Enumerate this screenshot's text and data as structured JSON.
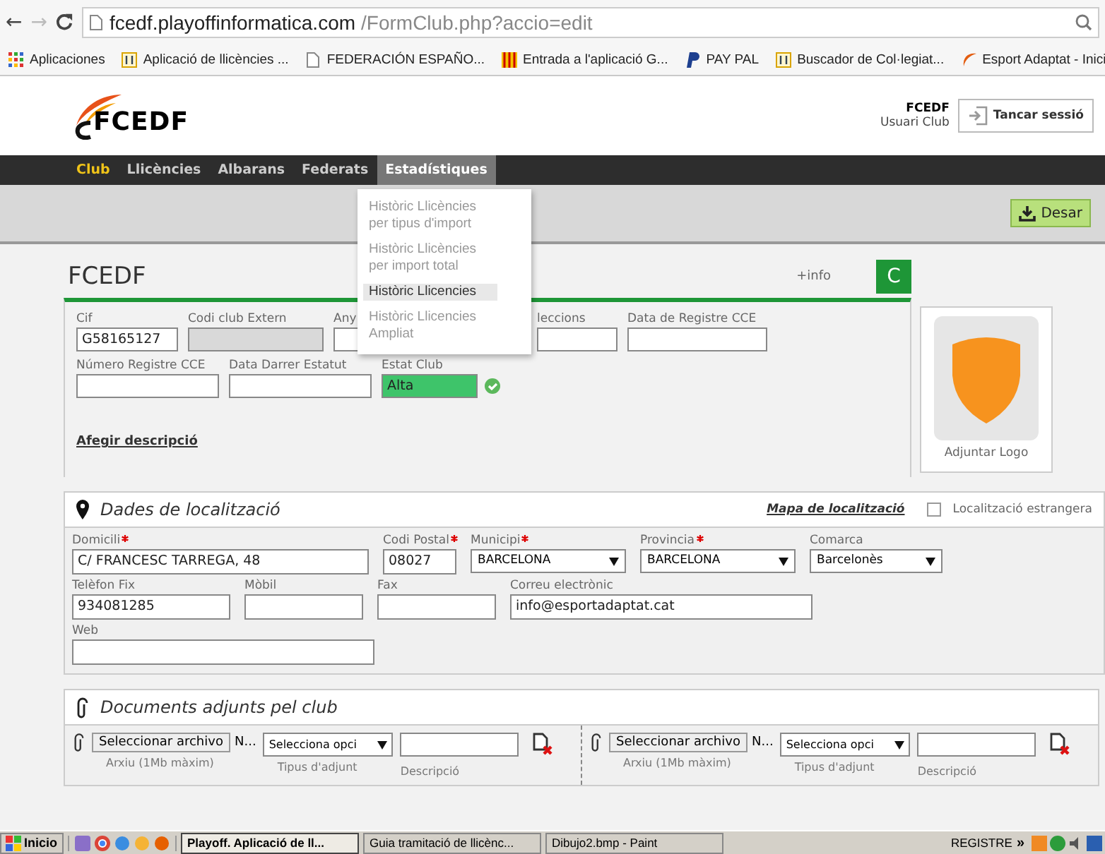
{
  "browser": {
    "back": "←",
    "forward": "→",
    "url_host": "fcedf.playoffinformatica.com",
    "url_path": "/FormClub.php?accio=edit",
    "bookmarks": [
      {
        "label": "Aplicaciones",
        "kind": "apps"
      },
      {
        "label": "Aplicació de llicències ...",
        "kind": "pi"
      },
      {
        "label": "FEDERACIÓN ESPAÑO...",
        "kind": "page"
      },
      {
        "label": "Entrada a l'aplicació G...",
        "kind": "flag"
      },
      {
        "label": "PAY PAL",
        "kind": "paypal"
      },
      {
        "label": "Buscador de Col·legiat...",
        "kind": "pi"
      },
      {
        "label": "Esport Adaptat - Inici",
        "kind": "swoosh"
      }
    ]
  },
  "header": {
    "logo_text": "FCEDF",
    "user_name": "FCEDF",
    "user_role": "Usuari Club",
    "logout": "Tancar sessió"
  },
  "nav": [
    {
      "label": "Club",
      "current": true,
      "open": false
    },
    {
      "label": "Llicències",
      "current": false,
      "open": false
    },
    {
      "label": "Albarans",
      "current": false,
      "open": false
    },
    {
      "label": "Federats",
      "current": false,
      "open": false
    },
    {
      "label": "Estadístiques",
      "current": false,
      "open": true
    }
  ],
  "menu": [
    {
      "label": "Històric Llicències per tipus d'import",
      "selected": false
    },
    {
      "label": "Històric Llicències per import total",
      "selected": false
    },
    {
      "label": "Històric Llicencies",
      "selected": true
    },
    {
      "label": "Històric Llicencies Ampliat",
      "selected": false
    }
  ],
  "toolbar": {
    "save": "Desar"
  },
  "club": {
    "title": "FCEDF",
    "info": "+info",
    "badge": "C",
    "link": "Afegir descripció",
    "logo_label": "Adjuntar Logo",
    "rows": [
      [
        {
          "label": "Cif",
          "value": "G58165127",
          "disabled": false
        },
        {
          "label": "Codi club Extern",
          "disabled": true
        },
        {
          "label": "Any",
          "disabled": false
        },
        {
          "label": "leccions",
          "disabled": false
        },
        {
          "label": "Data de Registre CCE",
          "disabled": false
        }
      ],
      [
        {
          "label": "Número Registre CCE",
          "disabled": false
        },
        {
          "label": "Data Darrer Estatut",
          "disabled": false
        },
        {
          "label": "Estat Club",
          "value": "Alta",
          "disabled": false,
          "valid": true
        }
      ]
    ]
  },
  "location": {
    "title": "Dades de localització",
    "map_link": "Mapa de localització",
    "foreign": {
      "label": "Localització estrangera",
      "checked": false
    },
    "fields": [
      {
        "label": "Domicili",
        "required": true,
        "kind": "input",
        "value": "C/ FRANCESC TARREGA, 48"
      },
      {
        "label": "Codi Postal",
        "required": true,
        "kind": "input",
        "value": "08027"
      },
      {
        "label": "Municipi",
        "required": true,
        "kind": "select",
        "value": "BARCELONA"
      },
      {
        "label": "Provincia",
        "required": true,
        "kind": "select",
        "value": "BARCELONA"
      },
      {
        "label": "Comarca",
        "required": false,
        "kind": "select",
        "value": "Barcelonès"
      },
      {
        "label": "Telèfon Fix",
        "required": false,
        "kind": "input",
        "value": "934081285"
      },
      {
        "label": "Mòbil",
        "required": false,
        "kind": "input"
      },
      {
        "label": "Fax",
        "required": false,
        "kind": "input"
      },
      {
        "label": "Correu electrònic",
        "required": false,
        "kind": "input",
        "value": "info@esportadaptat.cat"
      },
      {
        "label": "Web",
        "required": false,
        "kind": "input"
      }
    ]
  },
  "documents": {
    "title": "Documents adjunts pel club",
    "slots": [
      {
        "button": "Seleccionar archivo",
        "file": "N...",
        "select": "Selecciona opci",
        "file_hint": "Arxiu (1Mb màxim)",
        "type_label": "Tipus d'adjunt",
        "desc_label": "Descripció"
      },
      {
        "button": "Seleccionar archivo",
        "file": "N...",
        "select": "Selecciona opci",
        "file_hint": "Arxiu (1Mb màxim)",
        "type_label": "Tipus d'adjunt",
        "desc_label": "Descripció"
      }
    ]
  },
  "taskbar": {
    "start": "Inicio",
    "tasks": [
      {
        "label": "Playoff. Aplicació de ll...",
        "selected": true
      },
      {
        "label": "Guia tramitació de  llicènc...",
        "selected": false
      },
      {
        "label": "Dibujo2.bmp - Paint",
        "selected": false
      }
    ],
    "tray": "REGISTRE",
    "more": "»"
  }
}
